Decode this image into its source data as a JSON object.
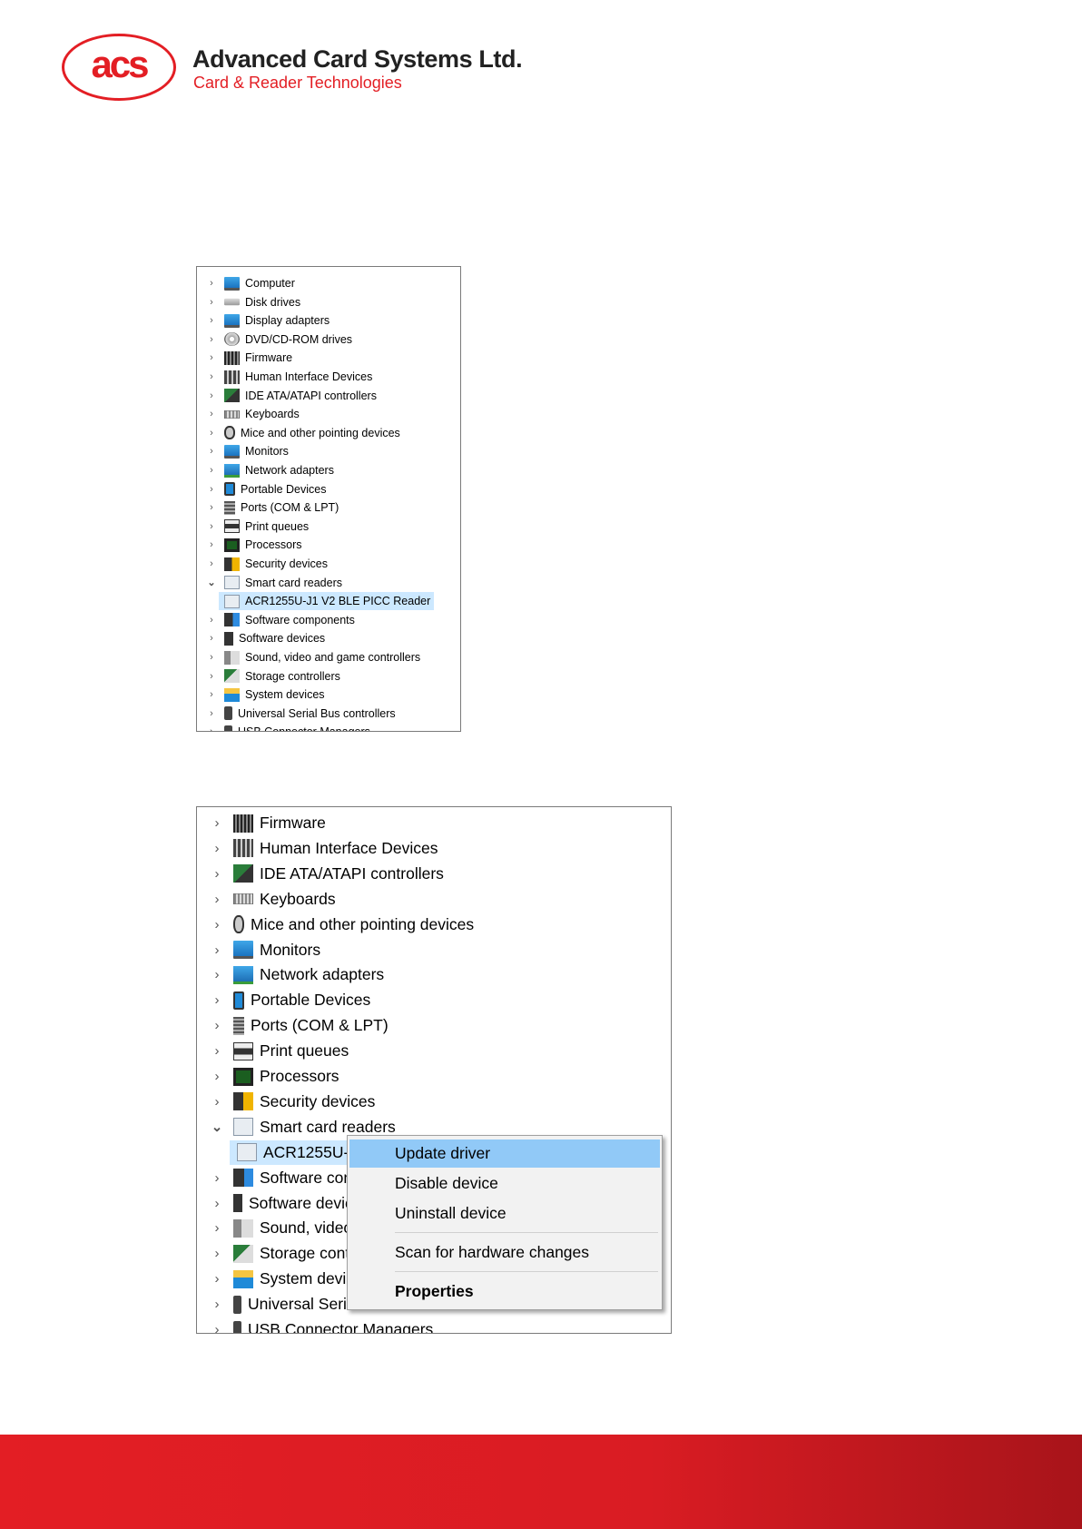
{
  "header": {
    "logo_text": "acs",
    "company_name": "Advanced Card Systems Ltd.",
    "tagline": "Card & Reader Technologies"
  },
  "colors": {
    "brand_red": "#e31e24",
    "selection_blue": "#cce8ff",
    "menu_highlight": "#91c9f7"
  },
  "panel1": {
    "items": [
      {
        "label": "Computer",
        "icon": "computer-icon",
        "expanded": false
      },
      {
        "label": "Disk drives",
        "icon": "disk-icon",
        "expanded": false
      },
      {
        "label": "Display adapters",
        "icon": "display-adapter-icon",
        "expanded": false
      },
      {
        "label": "DVD/CD-ROM drives",
        "icon": "dvd-icon",
        "expanded": false
      },
      {
        "label": "Firmware",
        "icon": "firmware-icon",
        "expanded": false
      },
      {
        "label": "Human Interface Devices",
        "icon": "hid-icon",
        "expanded": false
      },
      {
        "label": "IDE ATA/ATAPI controllers",
        "icon": "ide-icon",
        "expanded": false
      },
      {
        "label": "Keyboards",
        "icon": "keyboard-icon",
        "expanded": false
      },
      {
        "label": "Mice and other pointing devices",
        "icon": "mouse-icon",
        "expanded": false
      },
      {
        "label": "Monitors",
        "icon": "monitor-icon",
        "expanded": false
      },
      {
        "label": "Network adapters",
        "icon": "network-icon",
        "expanded": false
      },
      {
        "label": "Portable Devices",
        "icon": "portable-icon",
        "expanded": false
      },
      {
        "label": "Ports (COM & LPT)",
        "icon": "port-icon",
        "expanded": false
      },
      {
        "label": "Print queues",
        "icon": "printer-icon",
        "expanded": false
      },
      {
        "label": "Processors",
        "icon": "processor-icon",
        "expanded": false
      },
      {
        "label": "Security devices",
        "icon": "security-icon",
        "expanded": false
      },
      {
        "label": "Smart card readers",
        "icon": "smartcard-icon",
        "expanded": true
      },
      {
        "label": "ACR1255U-J1 V2 BLE PICC Reader",
        "icon": "smartcard-device-icon",
        "child": true
      },
      {
        "label": "Software components",
        "icon": "software-component-icon",
        "expanded": false
      },
      {
        "label": "Software devices",
        "icon": "software-device-icon",
        "expanded": false
      },
      {
        "label": "Sound, video and game controllers",
        "icon": "sound-icon",
        "expanded": false
      },
      {
        "label": "Storage controllers",
        "icon": "storage-icon",
        "expanded": false
      },
      {
        "label": "System devices",
        "icon": "system-icon",
        "expanded": false
      },
      {
        "label": "Universal Serial Bus controllers",
        "icon": "usb-icon",
        "expanded": false
      },
      {
        "label": "USB Connector Managers",
        "icon": "usb-connector-icon",
        "expanded": false
      }
    ]
  },
  "panel2": {
    "items": [
      {
        "label": "Firmware",
        "icon": "firmware-icon",
        "expanded": false
      },
      {
        "label": "Human Interface Devices",
        "icon": "hid-icon",
        "expanded": false
      },
      {
        "label": "IDE ATA/ATAPI controllers",
        "icon": "ide-icon",
        "expanded": false
      },
      {
        "label": "Keyboards",
        "icon": "keyboard-icon",
        "expanded": false
      },
      {
        "label": "Mice and other pointing devices",
        "icon": "mouse-icon",
        "expanded": false
      },
      {
        "label": "Monitors",
        "icon": "monitor-icon",
        "expanded": false
      },
      {
        "label": "Network adapters",
        "icon": "network-icon",
        "expanded": false
      },
      {
        "label": "Portable Devices",
        "icon": "portable-icon",
        "expanded": false
      },
      {
        "label": "Ports (COM & LPT)",
        "icon": "port-icon",
        "expanded": false
      },
      {
        "label": "Print queues",
        "icon": "printer-icon",
        "expanded": false
      },
      {
        "label": "Processors",
        "icon": "processor-icon",
        "expanded": false
      },
      {
        "label": "Security devices",
        "icon": "security-icon",
        "expanded": false
      },
      {
        "label": "Smart card readers",
        "icon": "smartcard-icon",
        "expanded": true
      },
      {
        "label": "ACR1255U-J1 V2 BLE PICC Reader",
        "icon": "smartcard-device-icon",
        "child": true
      },
      {
        "label": "Software components",
        "icon": "software-component-icon",
        "expanded": false
      },
      {
        "label": "Software devices",
        "icon": "software-device-icon",
        "expanded": false
      },
      {
        "label": "Sound, video and game controllers",
        "icon": "sound-icon",
        "expanded": false
      },
      {
        "label": "Storage controllers",
        "icon": "storage-icon",
        "expanded": false
      },
      {
        "label": "System devices",
        "icon": "system-icon",
        "expanded": false
      },
      {
        "label": "Universal Serial Bus controllers",
        "icon": "usb-icon",
        "expanded": false
      },
      {
        "label": "USB Connector Managers",
        "icon": "usb-connector-icon",
        "expanded": false
      }
    ]
  },
  "context_menu": {
    "update_driver": "Update driver",
    "disable_device": "Disable device",
    "uninstall_device": "Uninstall device",
    "scan_hardware": "Scan for hardware changes",
    "properties": "Properties",
    "highlighted": "Update driver"
  }
}
